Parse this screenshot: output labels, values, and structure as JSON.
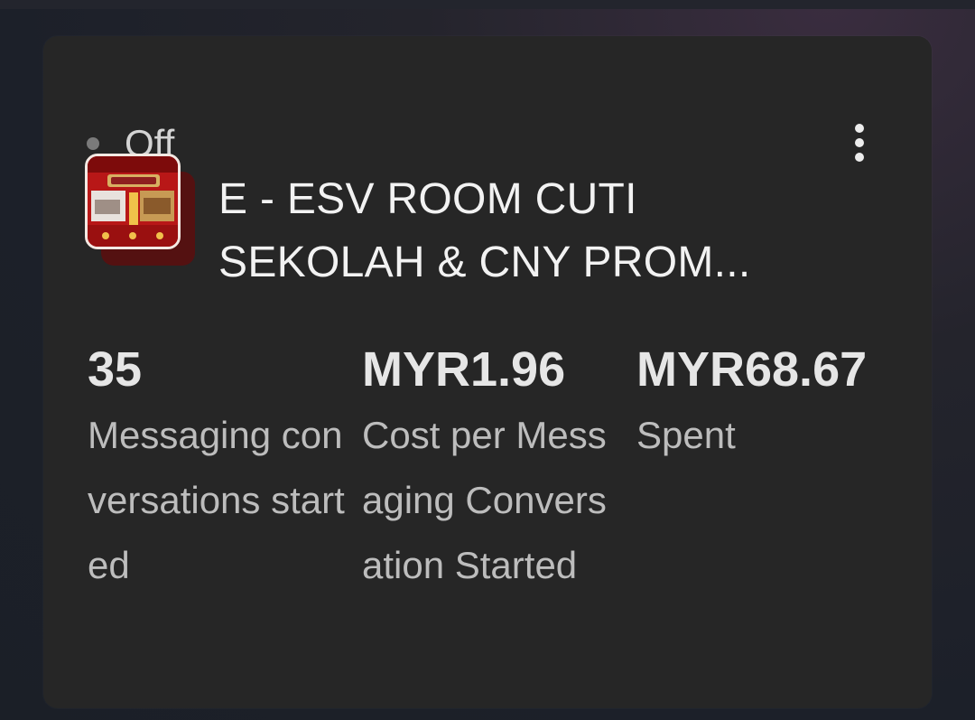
{
  "campaign": {
    "status": "Off",
    "title": "E - ESV ROOM CUTI SEKOLAH & CNY PROM...",
    "colors": {
      "card_background": "#262626",
      "status_dot": "#7a7a7a",
      "title_text": "#f2f2f2",
      "label_text": "#bdbdbd"
    },
    "icons": {
      "menu": "more-vertical-icon",
      "status": "status-dot-icon"
    },
    "metrics": [
      {
        "value": "35",
        "label": "Messaging conversations started"
      },
      {
        "value": "MYR1.96",
        "label": "Cost per Messaging Conversation Started"
      },
      {
        "value": "MYR68.67",
        "label": "Spent"
      }
    ]
  }
}
